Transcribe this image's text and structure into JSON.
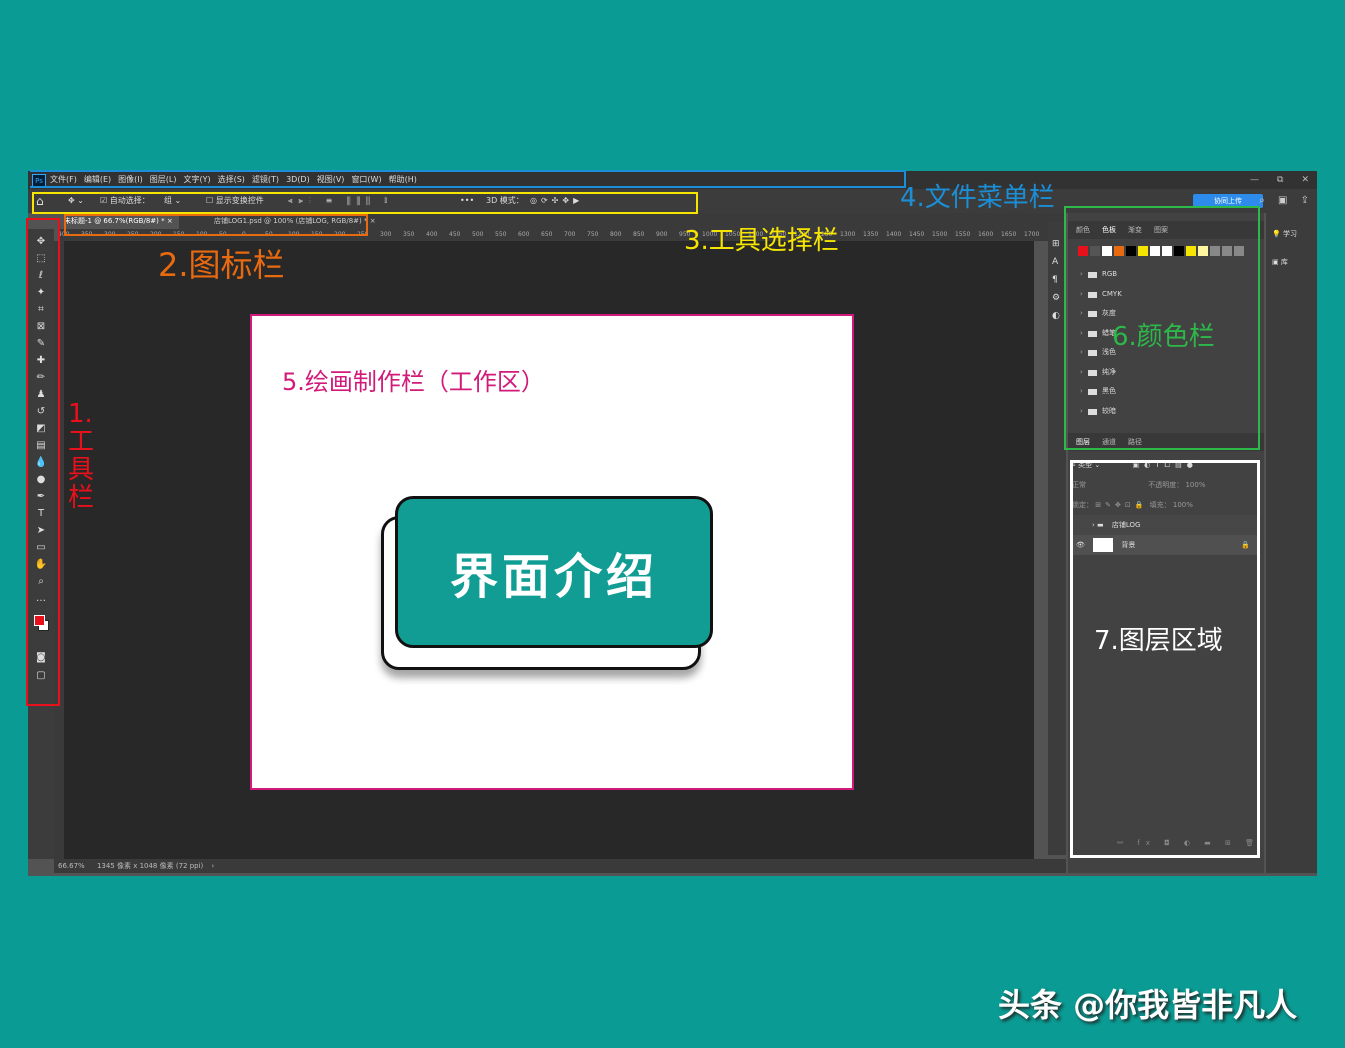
{
  "app": {
    "logo_text": "Ps",
    "menu": [
      "文件(F)",
      "编辑(E)",
      "图像(I)",
      "图层(L)",
      "文字(Y)",
      "选择(S)",
      "滤镜(T)",
      "3D(D)",
      "视图(V)",
      "窗口(W)",
      "帮助(H)"
    ],
    "window_controls": [
      "—",
      "⧉",
      "✕"
    ]
  },
  "options_bar": {
    "auto_select_label": "自动选择：",
    "auto_select_value": "组",
    "show_transform_label": "显示变换控件",
    "mode_3d_label": "3D 模式：",
    "share_button": "协同上传"
  },
  "doc_tabs": [
    {
      "label": "未标题-1 @ 66.7%(RGB/8#) *  ×",
      "active": true
    },
    {
      "label": "店铺LOG1.psd @ 100% (店铺LOG, RGB/8#) *  ×",
      "active": false
    }
  ],
  "ruler_marks": [
    "400",
    "350",
    "300",
    "250",
    "200",
    "150",
    "100",
    "50",
    "0",
    "50",
    "100",
    "150",
    "200",
    "250",
    "300",
    "350",
    "400",
    "450",
    "500",
    "550",
    "600",
    "650",
    "700",
    "750",
    "800",
    "850",
    "900",
    "950",
    "1000",
    "1050",
    "1100",
    "1150",
    "1200",
    "1250",
    "1300",
    "1350",
    "1400",
    "1450",
    "1500",
    "1550",
    "1600",
    "1650",
    "1700"
  ],
  "status": {
    "zoom": "66.67%",
    "info": "1345 像素 x 1048 像素 (72 ppi)"
  },
  "color_panel": {
    "tabs": [
      "颜色",
      "色板",
      "渐变",
      "图案"
    ],
    "swatches": [
      "#e8101a",
      "#555555",
      "#ffffff",
      "#e86a10",
      "#000000",
      "#f5e500",
      "#ffffff",
      "#ffffff",
      "#000000",
      "#f5e500",
      "#fff7a0",
      "#888888",
      "#888888",
      "#888888"
    ],
    "folders": [
      "RGB",
      "CMYK",
      "灰度",
      "蜡笔",
      "浅色",
      "纯净",
      "黑色",
      "较暗"
    ]
  },
  "layers_panel": {
    "tabs": [
      "图层",
      "通道",
      "路径"
    ],
    "kind_filter": "类型",
    "blend_mode": "正常",
    "opacity_label": "不透明度：",
    "opacity_value": "100%",
    "lock_label": "锁定：",
    "fill_label": "填充：",
    "fill_value": "100%",
    "layers": [
      {
        "name": "店铺LOG"
      },
      {
        "name": "背景"
      }
    ]
  },
  "right_strip": {
    "learn": "学习",
    "library": "库"
  },
  "canvas": {
    "card_text": "界面介绍"
  },
  "annotations": {
    "toolbar": "1.工具栏",
    "icon_bar": "2.图标栏",
    "tool_options": "3.工具选择栏",
    "file_menu": "4.文件菜单栏",
    "workspace": "5.绘画制作栏（工作区）",
    "color_bar": "6.颜色栏",
    "layers": "7.图层区域"
  },
  "watermark": "头条 @你我皆非凡人",
  "colors": {
    "bg": "#0a9c94",
    "red": "#e8101a",
    "orange": "#e86a10",
    "yellow": "#f5e500",
    "blue": "#1a8fd8",
    "magenta": "#d11a7a",
    "green": "#2db84a",
    "white": "#ffffff"
  }
}
